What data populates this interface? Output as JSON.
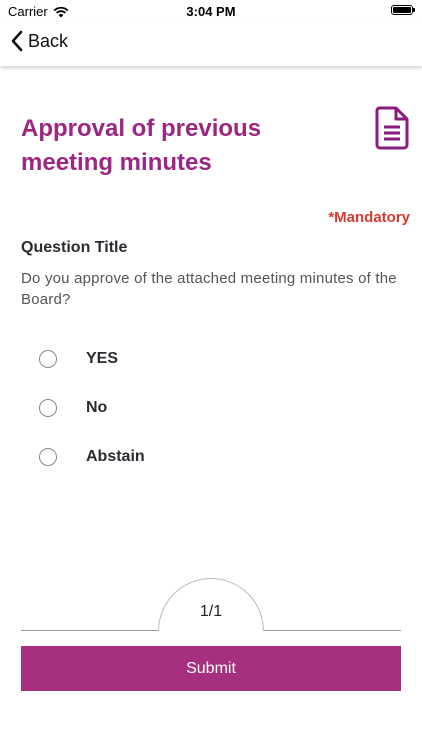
{
  "status": {
    "carrier": "Carrier",
    "time": "3:04 PM",
    "battery_level": 1.0
  },
  "nav": {
    "back_label": "Back"
  },
  "header": {
    "title": "Approval of previous meeting minutes",
    "icon": "document-icon",
    "accent": "#9b2782"
  },
  "mandatory_label": "*Mandatory",
  "question": {
    "title": "Question Title",
    "text": "Do you approve of the attached meeting minutes of the Board?"
  },
  "options": [
    {
      "label": "YES",
      "selected": false
    },
    {
      "label": "No",
      "selected": false
    },
    {
      "label": "Abstain",
      "selected": false
    }
  ],
  "pager": {
    "text": "1/1"
  },
  "submit": {
    "label": "Submit",
    "color": "#a6307f"
  }
}
